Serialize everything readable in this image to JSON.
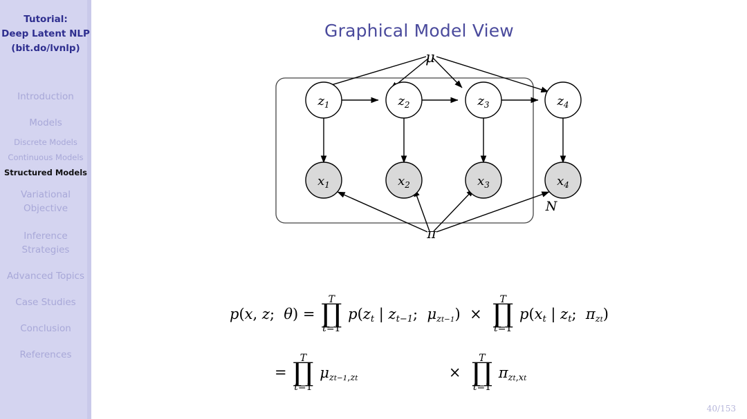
{
  "sidebar": {
    "title_lines": [
      "Tutorial:",
      "Deep Latent NLP",
      "(bit.do/lvnlp)"
    ],
    "sections": [
      {
        "label": "Introduction",
        "active": false
      },
      {
        "label": "Models",
        "active": false
      },
      {
        "label": "Variational Objective",
        "active": false
      },
      {
        "label": "Inference Strategies",
        "active": false
      },
      {
        "label": "Advanced Topics",
        "active": false
      },
      {
        "label": "Case Studies",
        "active": false
      },
      {
        "label": "Conclusion",
        "active": false
      },
      {
        "label": "References",
        "active": false
      }
    ],
    "subsections": [
      {
        "label": "Discrete Models",
        "active": false
      },
      {
        "label": "Continuous Models",
        "active": false
      },
      {
        "label": "Structured Models",
        "active": true
      }
    ],
    "colors": {
      "background": "#d4d4f0",
      "title": "#2e2e8f",
      "inactive": "#a8a8d8",
      "active": "#111111"
    }
  },
  "main": {
    "title": "Graphical Model View",
    "title_color": "#4a4a9c",
    "page_number": "40/153"
  },
  "figure": {
    "plate_label": "N",
    "hyperparam_top": "μ",
    "hyperparam_bottom": "π",
    "latent_nodes": [
      {
        "id": "z1",
        "base": "z",
        "sub": "1",
        "shaded": false
      },
      {
        "id": "z2",
        "base": "z",
        "sub": "2",
        "shaded": false
      },
      {
        "id": "z3",
        "base": "z",
        "sub": "3",
        "shaded": false
      },
      {
        "id": "z4",
        "base": "z",
        "sub": "4",
        "shaded": false
      }
    ],
    "observed_nodes": [
      {
        "id": "x1",
        "base": "x",
        "sub": "1",
        "shaded": true
      },
      {
        "id": "x2",
        "base": "x",
        "sub": "2",
        "shaded": true
      },
      {
        "id": "x3",
        "base": "x",
        "sub": "3",
        "shaded": true
      },
      {
        "id": "x4",
        "base": "x",
        "sub": "4",
        "shaded": true
      }
    ],
    "node_fill_shaded": "#d9d9d9",
    "node_fill_plain": "#ffffff",
    "stroke": "#000000"
  },
  "equations": {
    "line1": {
      "lhs": "p(x, z;  θ) =",
      "prod1": {
        "top": "T",
        "sym": "∏",
        "bottom": "t=1"
      },
      "term1": "p(zₜ | zₜ₋₁;  μ_{zₜ₋₁})",
      "times": "×",
      "prod2": {
        "top": "T",
        "sym": "∏",
        "bottom": "t=1"
      },
      "term2": "p(xₜ | zₜ;  π_{zₜ})"
    },
    "line2": {
      "lhs": "=",
      "prod1": {
        "top": "T",
        "sym": "∏",
        "bottom": "t=1"
      },
      "term1": "μ_{zₜ₋₁, zₜ}",
      "times": "×",
      "prod2": {
        "top": "T",
        "sym": "∏",
        "bottom": "t=1"
      },
      "term2": "π_{zₜ, xₜ}"
    }
  }
}
